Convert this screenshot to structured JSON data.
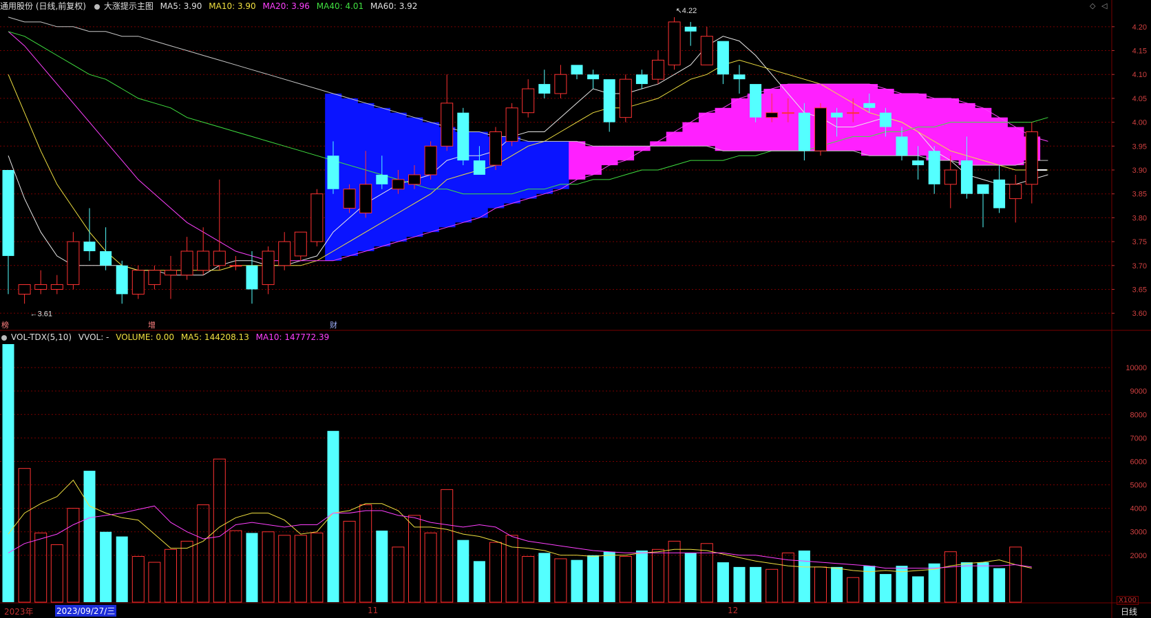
{
  "header": {
    "stock_title": "通用股份 (日线,前复权)",
    "indicator_name": "大涨提示主图",
    "ma5": "MA5: 3.90",
    "ma10": "MA10: 3.90",
    "ma20": "MA20: 3.96",
    "ma40": "MA40: 4.01",
    "ma60": "MA60: 3.92"
  },
  "volume_header": {
    "indicator": "VOL-TDX(5,10)",
    "vvol": "VVOL: -",
    "volume": "VOLUME: 0.00",
    "ma5": "MA5: 144208.13",
    "ma10": "MA10: 147772.39"
  },
  "footer": {
    "year_label": "2023年",
    "date_label": "2023/09/27/三",
    "month_11": "11",
    "month_12": "12",
    "period": "日线",
    "vol_unit": "X100"
  },
  "colors": {
    "up": "#ff3232",
    "down": "#54ffff",
    "ma5": "#e8e8e8",
    "ma10": "#f0e040",
    "ma20": "#ff40ff",
    "ma40": "#40e040",
    "ma60": "#c8c8c8",
    "cloud_blue": "#0a14ff",
    "cloud_magenta": "#ff20ff",
    "grid": "#7a0000"
  },
  "chart_data": [
    {
      "type": "candlestick",
      "title": "通用股份 (日线,前复权)",
      "ylim": [
        3.57,
        4.23
      ],
      "y_ticks": [
        "4.20",
        "4.15",
        "4.10",
        "4.05",
        "4.00",
        "3.95",
        "3.90",
        "3.85",
        "3.80",
        "3.75",
        "3.70",
        "3.65",
        "3.60"
      ],
      "annotations": {
        "high": "4.22",
        "low": "←3.61",
        "markers": [
          "榜",
          "增",
          "财"
        ]
      },
      "candles": [
        {
          "o": 3.9,
          "h": 3.9,
          "l": 3.64,
          "c": 3.72
        },
        {
          "o": 3.64,
          "h": 3.66,
          "l": 3.62,
          "c": 3.66
        },
        {
          "o": 3.65,
          "h": 3.69,
          "l": 3.64,
          "c": 3.66
        },
        {
          "o": 3.65,
          "h": 3.68,
          "l": 3.64,
          "c": 3.66
        },
        {
          "o": 3.66,
          "h": 3.77,
          "l": 3.65,
          "c": 3.75
        },
        {
          "o": 3.75,
          "h": 3.82,
          "l": 3.71,
          "c": 3.73
        },
        {
          "o": 3.73,
          "h": 3.78,
          "l": 3.69,
          "c": 3.7
        },
        {
          "o": 3.7,
          "h": 3.71,
          "l": 3.62,
          "c": 3.64
        },
        {
          "o": 3.64,
          "h": 3.7,
          "l": 3.63,
          "c": 3.69
        },
        {
          "o": 3.66,
          "h": 3.7,
          "l": 3.65,
          "c": 3.69
        },
        {
          "o": 3.68,
          "h": 3.72,
          "l": 3.63,
          "c": 3.69
        },
        {
          "o": 3.68,
          "h": 3.76,
          "l": 3.67,
          "c": 3.73
        },
        {
          "o": 3.69,
          "h": 3.78,
          "l": 3.68,
          "c": 3.73
        },
        {
          "o": 3.7,
          "h": 3.88,
          "l": 3.69,
          "c": 3.73
        },
        {
          "o": 3.7,
          "h": 3.72,
          "l": 3.69,
          "c": 3.7
        },
        {
          "o": 3.7,
          "h": 3.73,
          "l": 3.62,
          "c": 3.65
        },
        {
          "o": 3.66,
          "h": 3.74,
          "l": 3.64,
          "c": 3.73
        },
        {
          "o": 3.7,
          "h": 3.77,
          "l": 3.69,
          "c": 3.75
        },
        {
          "o": 3.72,
          "h": 3.77,
          "l": 3.71,
          "c": 3.77
        },
        {
          "o": 3.75,
          "h": 3.86,
          "l": 3.74,
          "c": 3.85
        },
        {
          "o": 3.93,
          "h": 3.96,
          "l": 3.85,
          "c": 3.86
        },
        {
          "o": 3.82,
          "h": 3.87,
          "l": 3.81,
          "c": 3.86
        },
        {
          "o": 3.81,
          "h": 3.94,
          "l": 3.8,
          "c": 3.87
        },
        {
          "o": 3.89,
          "h": 3.93,
          "l": 3.86,
          "c": 3.87
        },
        {
          "o": 3.86,
          "h": 3.9,
          "l": 3.85,
          "c": 3.88
        },
        {
          "o": 3.87,
          "h": 3.91,
          "l": 3.86,
          "c": 3.89
        },
        {
          "o": 3.89,
          "h": 3.96,
          "l": 3.88,
          "c": 3.95
        },
        {
          "o": 3.95,
          "h": 4.1,
          "l": 3.94,
          "c": 4.04
        },
        {
          "o": 4.02,
          "h": 4.03,
          "l": 3.91,
          "c": 3.92
        },
        {
          "o": 3.92,
          "h": 3.95,
          "l": 3.89,
          "c": 3.89
        },
        {
          "o": 3.91,
          "h": 3.99,
          "l": 3.9,
          "c": 3.98
        },
        {
          "o": 3.96,
          "h": 4.04,
          "l": 3.95,
          "c": 4.03
        },
        {
          "o": 4.02,
          "h": 4.09,
          "l": 4.01,
          "c": 4.07
        },
        {
          "o": 4.08,
          "h": 4.11,
          "l": 4.05,
          "c": 4.06
        },
        {
          "o": 4.06,
          "h": 4.12,
          "l": 4.05,
          "c": 4.1
        },
        {
          "o": 4.12,
          "h": 4.12,
          "l": 4.09,
          "c": 4.1
        },
        {
          "o": 4.1,
          "h": 4.11,
          "l": 4.07,
          "c": 4.09
        },
        {
          "o": 4.09,
          "h": 4.09,
          "l": 3.98,
          "c": 4.0
        },
        {
          "o": 4.01,
          "h": 4.1,
          "l": 4.0,
          "c": 4.09
        },
        {
          "o": 4.1,
          "h": 4.11,
          "l": 4.07,
          "c": 4.08
        },
        {
          "o": 4.09,
          "h": 4.15,
          "l": 4.08,
          "c": 4.13
        },
        {
          "o": 4.12,
          "h": 4.22,
          "l": 4.11,
          "c": 4.21
        },
        {
          "o": 4.2,
          "h": 4.21,
          "l": 4.16,
          "c": 4.19
        },
        {
          "o": 4.12,
          "h": 4.2,
          "l": 4.12,
          "c": 4.18
        },
        {
          "o": 4.17,
          "h": 4.17,
          "l": 4.08,
          "c": 4.1
        },
        {
          "o": 4.1,
          "h": 4.12,
          "l": 4.06,
          "c": 4.09
        },
        {
          "o": 4.08,
          "h": 4.08,
          "l": 4.0,
          "c": 4.01
        },
        {
          "o": 4.01,
          "h": 4.06,
          "l": 4.0,
          "c": 4.02
        },
        {
          "o": 4.02,
          "h": 4.05,
          "l": 4.0,
          "c": 4.02
        },
        {
          "o": 4.02,
          "h": 4.04,
          "l": 3.92,
          "c": 3.94
        },
        {
          "o": 3.94,
          "h": 4.04,
          "l": 3.93,
          "c": 4.03
        },
        {
          "o": 4.02,
          "h": 4.03,
          "l": 3.97,
          "c": 4.01
        },
        {
          "o": 4.02,
          "h": 4.05,
          "l": 4.0,
          "c": 4.02
        },
        {
          "o": 4.04,
          "h": 4.06,
          "l": 4.02,
          "c": 4.03
        },
        {
          "o": 4.02,
          "h": 4.03,
          "l": 3.97,
          "c": 3.99
        },
        {
          "o": 3.97,
          "h": 3.99,
          "l": 3.92,
          "c": 3.93
        },
        {
          "o": 3.92,
          "h": 3.95,
          "l": 3.88,
          "c": 3.91
        },
        {
          "o": 3.94,
          "h": 3.95,
          "l": 3.85,
          "c": 3.87
        },
        {
          "o": 3.87,
          "h": 3.93,
          "l": 3.82,
          "c": 3.9
        },
        {
          "o": 3.92,
          "h": 3.97,
          "l": 3.84,
          "c": 3.85
        },
        {
          "o": 3.87,
          "h": 3.87,
          "l": 3.78,
          "c": 3.85
        },
        {
          "o": 3.88,
          "h": 3.91,
          "l": 3.81,
          "c": 3.82
        },
        {
          "o": 3.84,
          "h": 3.89,
          "l": 3.79,
          "c": 3.87
        },
        {
          "o": 3.87,
          "h": 4.0,
          "l": 3.83,
          "c": 3.98
        }
      ],
      "ma_lines": {
        "ma5": [
          3.93,
          3.84,
          3.77,
          3.72,
          3.7,
          3.7,
          3.7,
          3.7,
          3.69,
          3.69,
          3.68,
          3.68,
          3.68,
          3.7,
          3.71,
          3.71,
          3.7,
          3.7,
          3.71,
          3.72,
          3.77,
          3.8,
          3.83,
          3.85,
          3.87,
          3.88,
          3.89,
          3.92,
          3.93,
          3.93,
          3.94,
          3.97,
          3.98,
          3.98,
          4.01,
          4.04,
          4.07,
          4.06,
          4.06,
          4.07,
          4.08,
          4.1,
          4.12,
          4.16,
          4.18,
          4.17,
          4.14,
          4.1,
          4.06,
          4.02,
          4.01,
          3.99,
          3.99,
          4.0,
          4.01,
          4.0,
          3.98,
          3.94,
          3.92,
          3.89,
          3.88,
          3.87,
          3.87,
          3.88,
          3.89
        ],
        "ma10": [
          4.1,
          4.02,
          3.94,
          3.87,
          3.82,
          3.77,
          3.73,
          3.7,
          3.69,
          3.69,
          3.69,
          3.69,
          3.69,
          3.69,
          3.7,
          3.7,
          3.7,
          3.7,
          3.7,
          3.71,
          3.73,
          3.75,
          3.77,
          3.79,
          3.81,
          3.83,
          3.85,
          3.88,
          3.89,
          3.9,
          3.91,
          3.93,
          3.95,
          3.96,
          3.98,
          4.0,
          4.02,
          4.03,
          4.03,
          4.04,
          4.05,
          4.07,
          4.09,
          4.1,
          4.12,
          4.13,
          4.12,
          4.11,
          4.1,
          4.09,
          4.08,
          4.06,
          4.04,
          4.02,
          4.01,
          4.0,
          3.98,
          3.96,
          3.94,
          3.93,
          3.92,
          3.91,
          3.9,
          3.9,
          3.9
        ],
        "ma20": [
          4.19,
          4.16,
          4.12,
          4.08,
          4.04,
          4.0,
          3.96,
          3.92,
          3.88,
          3.85,
          3.82,
          3.79,
          3.77,
          3.75,
          3.73,
          3.72,
          3.71,
          3.71,
          3.71,
          3.71,
          3.71,
          3.72,
          3.73,
          3.74,
          3.75,
          3.76,
          3.77,
          3.78,
          3.79,
          3.8,
          3.82,
          3.83,
          3.84,
          3.85,
          3.86,
          3.88,
          3.89,
          3.91,
          3.92,
          3.94,
          3.96,
          3.98,
          4.0,
          4.02,
          4.03,
          4.05,
          4.06,
          4.07,
          4.08,
          4.08,
          4.08,
          4.08,
          4.08,
          4.08,
          4.07,
          4.06,
          4.06,
          4.05,
          4.05,
          4.04,
          4.03,
          4.01,
          3.99,
          3.97,
          3.96
        ],
        "ma40": [
          4.19,
          4.18,
          4.16,
          4.14,
          4.12,
          4.1,
          4.09,
          4.07,
          4.05,
          4.04,
          4.03,
          4.01,
          4.0,
          3.99,
          3.98,
          3.97,
          3.96,
          3.95,
          3.94,
          3.93,
          3.92,
          3.91,
          3.9,
          3.89,
          3.88,
          3.87,
          3.86,
          3.86,
          3.85,
          3.85,
          3.85,
          3.85,
          3.86,
          3.86,
          3.87,
          3.87,
          3.88,
          3.88,
          3.89,
          3.9,
          3.9,
          3.91,
          3.92,
          3.92,
          3.92,
          3.93,
          3.93,
          3.94,
          3.94,
          3.94,
          3.95,
          3.96,
          3.97,
          3.97,
          3.98,
          3.98,
          3.99,
          3.99,
          4.0,
          4.0,
          4.0,
          4.0,
          4.0,
          4.0,
          4.01
        ],
        "ma60": [
          4.22,
          4.21,
          4.21,
          4.2,
          4.2,
          4.19,
          4.19,
          4.18,
          4.18,
          4.17,
          4.16,
          4.15,
          4.14,
          4.13,
          4.12,
          4.11,
          4.1,
          4.09,
          4.08,
          4.07,
          4.06,
          4.05,
          4.04,
          4.03,
          4.02,
          4.01,
          4.0,
          3.99,
          3.98,
          3.98,
          3.97,
          3.97,
          3.96,
          3.96,
          3.96,
          3.96,
          3.95,
          3.95,
          3.95,
          3.95,
          3.95,
          3.95,
          3.95,
          3.95,
          3.94,
          3.94,
          3.94,
          3.94,
          3.94,
          3.94,
          3.94,
          3.94,
          3.94,
          3.93,
          3.93,
          3.93,
          3.93,
          3.92,
          3.92,
          3.91,
          3.91,
          3.91,
          3.91,
          3.92,
          3.92
        ]
      }
    },
    {
      "type": "bar",
      "title": "VOL-TDX(5,10)",
      "unit": "X100",
      "ylim": [
        0,
        11000
      ],
      "y_ticks": [
        "10000",
        "9000",
        "8000",
        "7000",
        "6000",
        "5000",
        "4000",
        "3000",
        "2000"
      ],
      "volumes": [
        11000,
        5700,
        2950,
        2450,
        4000,
        5600,
        3000,
        2800,
        1950,
        1700,
        2250,
        2600,
        4150,
        6100,
        3050,
        2950,
        3000,
        2850,
        2850,
        2950,
        7300,
        3450,
        4150,
        3050,
        2350,
        3700,
        2950,
        4800,
        2650,
        1750,
        2550,
        2850,
        1950,
        2100,
        1850,
        1800,
        2000,
        2150,
        1950,
        2200,
        2250,
        2600,
        2100,
        2500,
        1700,
        1500,
        1500,
        1400,
        2100,
        2200,
        1500,
        1500,
        1050,
        1550,
        1200,
        1550,
        1100,
        1650,
        2150,
        1700,
        1700,
        1450,
        2350,
        0
      ],
      "ma5": [
        2900,
        3800,
        4200,
        4500,
        5200,
        4100,
        3800,
        3600,
        3500,
        2900,
        2300,
        2300,
        2600,
        3200,
        3600,
        3800,
        3800,
        3500,
        2900,
        3000,
        3800,
        3900,
        4200,
        4200,
        3900,
        3200,
        3200,
        3100,
        2900,
        2800,
        2600,
        2350,
        2300,
        2200,
        2000,
        2000,
        1950,
        2000,
        2000,
        2100,
        2150,
        2250,
        2250,
        2200,
        2050,
        1900,
        1750,
        1650,
        1550,
        1500,
        1500,
        1450,
        1350,
        1300,
        1350,
        1300,
        1350,
        1400,
        1550,
        1650,
        1700,
        1800,
        1600,
        1450
      ],
      "ma10": [
        2100,
        2500,
        2700,
        2900,
        3300,
        3600,
        3700,
        3800,
        3950,
        4100,
        3400,
        3000,
        2700,
        2800,
        3300,
        3400,
        3300,
        3200,
        3300,
        3300,
        3800,
        3800,
        3900,
        3900,
        3700,
        3600,
        3400,
        3300,
        3200,
        3300,
        3200,
        2800,
        2600,
        2500,
        2400,
        2300,
        2200,
        2150,
        2100,
        2100,
        2100,
        2100,
        2100,
        2100,
        2100,
        2000,
        2000,
        1900,
        1800,
        1750,
        1700,
        1650,
        1600,
        1550,
        1450,
        1450,
        1450,
        1450,
        1500,
        1550,
        1550,
        1550,
        1600,
        1500
      ]
    }
  ]
}
